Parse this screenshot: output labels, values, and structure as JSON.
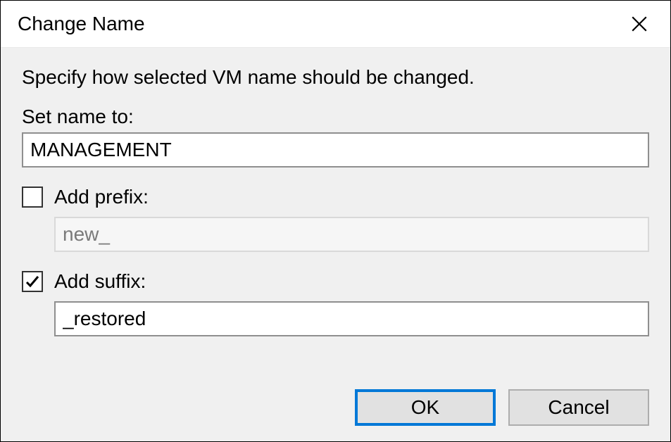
{
  "window": {
    "title": "Change Name"
  },
  "instruction": "Specify how selected VM name should be changed.",
  "set_name": {
    "label": "Set name to:",
    "value": "MANAGEMENT"
  },
  "prefix": {
    "label": "Add prefix:",
    "checked": false,
    "value": "new_"
  },
  "suffix": {
    "label": "Add suffix:",
    "checked": true,
    "value": "_restored"
  },
  "buttons": {
    "ok": "OK",
    "cancel": "Cancel"
  }
}
